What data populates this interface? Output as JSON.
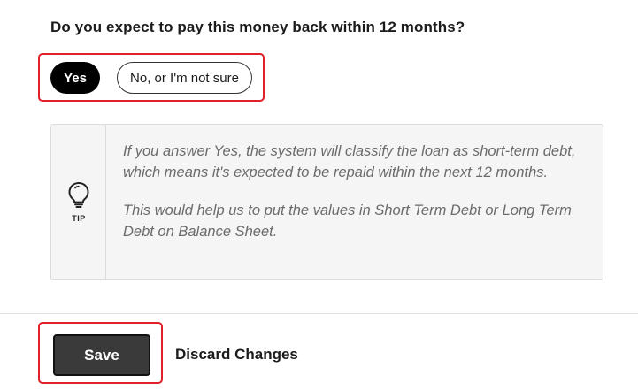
{
  "question": {
    "text": "Do you expect to pay this money back within 12 months?",
    "options": [
      {
        "label": "Yes",
        "selected": true
      },
      {
        "label": "No, or I'm not sure",
        "selected": false
      }
    ]
  },
  "tip": {
    "icon": "lightbulb-icon",
    "label": "TIP",
    "paragraphs": [
      "If you answer Yes, the system will classify the loan as short-term debt, which means it's expected to be repaid within the next 12 months.",
      "This would help us to put the values in Short Term Debt or Long Term Debt on Balance Sheet."
    ]
  },
  "actions": {
    "save_label": "Save",
    "discard_label": "Discard Changes"
  },
  "colors": {
    "highlight": "#e0202a",
    "selected_pill": "#000000",
    "save_button": "#3a3a3a"
  }
}
